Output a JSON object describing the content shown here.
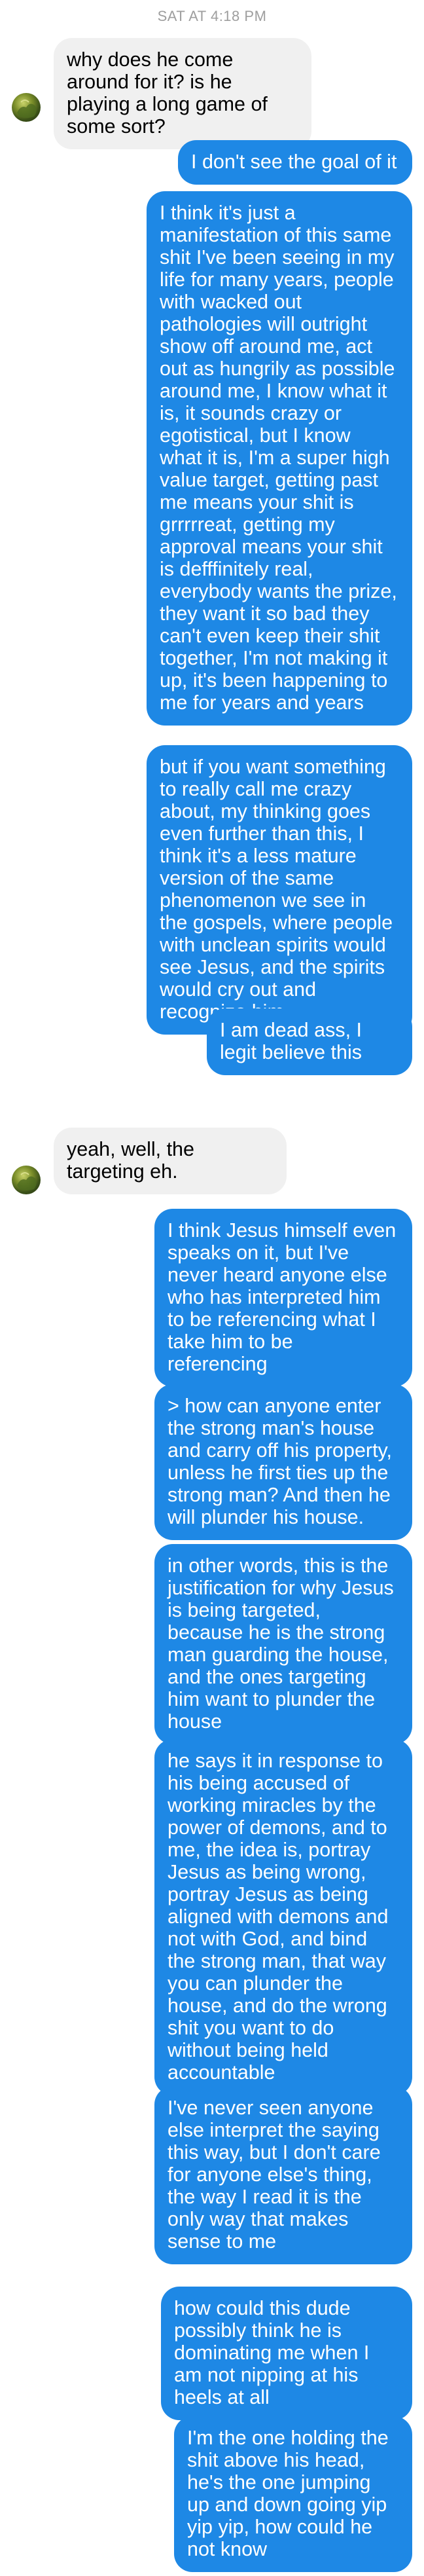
{
  "header": {
    "timestamp": "SAT AT 4:18 PM"
  },
  "messages": [
    {
      "direction": "in",
      "text": "why does he come around for it? is he playing a long game of some sort?"
    },
    {
      "direction": "out",
      "text": "I don't see the goal of it"
    },
    {
      "direction": "out",
      "text": "I think it's just a manifestation of this same shit I've been seeing in my life for many years, people with wacked out pathologies will outright show off around me, act out as hungrily as possible around me, I know what it is, it sounds crazy or egotistical, but I know what it is, I'm a super high value target, getting past me means your shit is grrrrreat, getting my approval means your shit is defffinitely real, everybody wants the prize, they want it so bad they can't even keep their shit together, I'm not making it up, it's been happening to me for years and years"
    },
    {
      "direction": "out",
      "text": "but if you want something to really call me crazy about, my thinking goes even further than this, I think it's a less mature version of the same phenomenon we see in the gospels, where people with unclean spirits would see Jesus, and the spirits would cry out and recognize him"
    },
    {
      "direction": "out",
      "text": "I am dead ass, I legit believe this"
    },
    {
      "direction": "in",
      "text": "yeah, well, the targeting eh."
    },
    {
      "direction": "out",
      "text": "I think Jesus himself even speaks on it, but I've never heard anyone else who has interpreted him to be referencing what I take him to be referencing"
    },
    {
      "direction": "out",
      "text": "> how can anyone enter the strong man's house and carry off his property, unless he first ties up the strong man? And then he will plunder his house."
    },
    {
      "direction": "out",
      "text": "in other words, this is the justification for why Jesus is being targeted, because he is the strong man guarding the house, and the ones targeting him want to plunder the house"
    },
    {
      "direction": "out",
      "text": "he says it in response to his being accused of working miracles by the power of demons, and to me, the idea is, portray Jesus as being wrong, portray Jesus as being aligned with demons and not with God, and bind the strong man, that way you can plunder the house, and do the wrong shit you want to do without being held accountable"
    },
    {
      "direction": "out",
      "text": "I've never seen anyone else interpret the saying this way, but I don't care for anyone else's thing, the way I read it is the only way that makes sense to me"
    },
    {
      "direction": "out",
      "text": "how could this dude possibly think he is dominating me when I am not nipping at his heels at all"
    },
    {
      "direction": "out",
      "text": "I'm the one holding the shit above his head, he's the one jumping up and down going yip yip yip, how could he not know"
    }
  ],
  "icons": {
    "avatar": "contact-avatar-icon"
  },
  "colors": {
    "outgoing_bubble": "#1e88e5",
    "incoming_bubble": "#f0f0f0",
    "timestamp": "#9e9e9e"
  }
}
